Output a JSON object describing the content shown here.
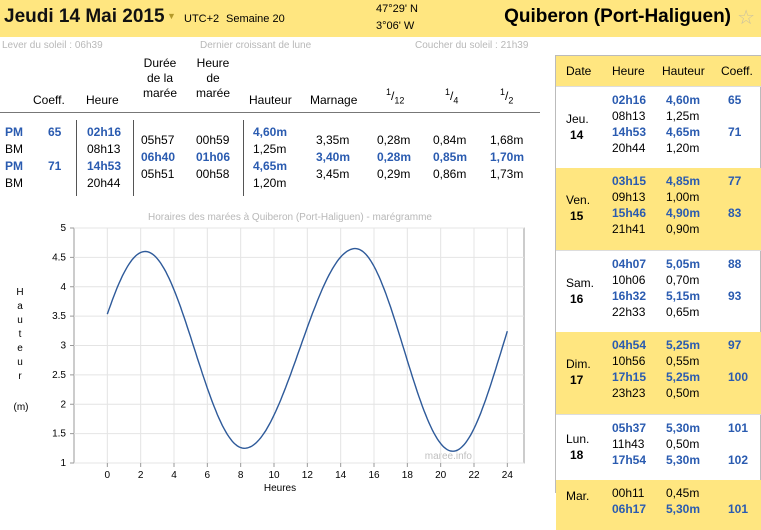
{
  "header": {
    "date": "Jeudi 14 Mai 2015",
    "timezone": "UTC+2",
    "week": "Semaine 20",
    "lat": "47°29' N",
    "lon": "3°06' W",
    "place": "Quiberon (Port-Haliguen)",
    "star_icon": "star-icon"
  },
  "subinfo": {
    "sunrise": "Lever du soleil : 06h39",
    "moon": "Dernier croissant de lune",
    "sunset": "Coucher du soleil : 21h39"
  },
  "table": {
    "headers": {
      "coeff": "Coeff.",
      "heure": "Heure",
      "duree": "Durée de la marée",
      "heure_maree": "Heure de marée",
      "hauteur": "Hauteur",
      "marnage": "Marnage",
      "f12_num": "1",
      "f12_den": "12",
      "f4_num": "1",
      "f4_den": "4",
      "f2_num": "1",
      "f2_den": "2"
    },
    "rows": [
      {
        "type": "PM",
        "coeff": "65",
        "heure": "02h16",
        "hauteur": "4,60m"
      },
      {
        "type": "BM",
        "coeff": "",
        "heure": "08h13",
        "hauteur": "1,25m"
      },
      {
        "type": "PM",
        "coeff": "71",
        "heure": "14h53",
        "hauteur": "4,65m"
      },
      {
        "type": "BM",
        "coeff": "",
        "heure": "20h44",
        "hauteur": "1,20m"
      }
    ],
    "intervals": [
      {
        "duree": "05h57",
        "heure_maree": "00h59",
        "marnage": "3,35m",
        "f12": "0,28m",
        "f4": "0,84m",
        "f2": "1,68m"
      },
      {
        "duree": "06h40",
        "heure_maree": "01h06",
        "marnage": "3,40m",
        "f12": "0,28m",
        "f4": "0,85m",
        "f2": "1,70m"
      },
      {
        "duree": "05h51",
        "heure_maree": "00h58",
        "marnage": "3,45m",
        "f12": "0,29m",
        "f4": "0,86m",
        "f2": "1,73m"
      }
    ]
  },
  "chart_data": {
    "type": "line",
    "title": "Horaires des marées à Quiberon (Port-Haliguen) - marégramme",
    "xlabel": "Heures",
    "ylabel": "Hauteur (m)",
    "ylabel_letters": [
      "H",
      "a",
      "u",
      "t",
      "e",
      "u",
      "r"
    ],
    "ylabel_unit": "(m)",
    "xlim": [
      -2,
      25
    ],
    "ylim": [
      1,
      5
    ],
    "xticks": [
      "0",
      "2",
      "4",
      "6",
      "8",
      "10",
      "12",
      "14",
      "16",
      "18",
      "20",
      "22",
      "24"
    ],
    "yticks": [
      "1",
      "1.5",
      "2",
      "2.5",
      "3",
      "3.5",
      "4",
      "4.5",
      "5"
    ],
    "watermark": "maree.info",
    "series": [
      {
        "x": [
          0,
          2.27,
          8.22,
          14.88,
          20.73,
          24
        ],
        "y": [
          3.9,
          4.6,
          1.25,
          4.65,
          1.2,
          3.25
        ]
      }
    ]
  },
  "side": {
    "headers": [
      "Date",
      "Heure",
      "Hauteur",
      "Coeff."
    ],
    "days": [
      {
        "day": "Jeu.",
        "num": "14",
        "highlight": false,
        "tides": [
          {
            "time": "02h16",
            "height": "4,60m",
            "coeff": "65",
            "pm": true
          },
          {
            "time": "08h13",
            "height": "1,25m",
            "coeff": "",
            "pm": false
          },
          {
            "time": "14h53",
            "height": "4,65m",
            "coeff": "71",
            "pm": true
          },
          {
            "time": "20h44",
            "height": "1,20m",
            "coeff": "",
            "pm": false
          }
        ]
      },
      {
        "day": "Ven.",
        "num": "15",
        "highlight": true,
        "tides": [
          {
            "time": "03h15",
            "height": "4,85m",
            "coeff": "77",
            "pm": true
          },
          {
            "time": "09h13",
            "height": "1,00m",
            "coeff": "",
            "pm": false
          },
          {
            "time": "15h46",
            "height": "4,90m",
            "coeff": "83",
            "pm": true
          },
          {
            "time": "21h41",
            "height": "0,90m",
            "coeff": "",
            "pm": false
          }
        ]
      },
      {
        "day": "Sam.",
        "num": "16",
        "highlight": false,
        "tides": [
          {
            "time": "04h07",
            "height": "5,05m",
            "coeff": "88",
            "pm": true
          },
          {
            "time": "10h06",
            "height": "0,70m",
            "coeff": "",
            "pm": false
          },
          {
            "time": "16h32",
            "height": "5,15m",
            "coeff": "93",
            "pm": true
          },
          {
            "time": "22h33",
            "height": "0,65m",
            "coeff": "",
            "pm": false
          }
        ]
      },
      {
        "day": "Dim.",
        "num": "17",
        "highlight": true,
        "tides": [
          {
            "time": "04h54",
            "height": "5,25m",
            "coeff": "97",
            "pm": true
          },
          {
            "time": "10h56",
            "height": "0,55m",
            "coeff": "",
            "pm": false
          },
          {
            "time": "17h15",
            "height": "5,25m",
            "coeff": "100",
            "pm": true
          },
          {
            "time": "23h23",
            "height": "0,50m",
            "coeff": "",
            "pm": false
          }
        ]
      },
      {
        "day": "Lun.",
        "num": "18",
        "highlight": false,
        "tides": [
          {
            "time": "05h37",
            "height": "5,30m",
            "coeff": "101",
            "pm": true
          },
          {
            "time": "11h43",
            "height": "0,50m",
            "coeff": "",
            "pm": false
          },
          {
            "time": "17h54",
            "height": "5,30m",
            "coeff": "102",
            "pm": true
          }
        ]
      },
      {
        "day": "Mar.",
        "num": "",
        "highlight": true,
        "tides": [
          {
            "time": "00h11",
            "height": "0,45m",
            "coeff": "",
            "pm": false
          },
          {
            "time": "06h17",
            "height": "5,30m",
            "coeff": "101",
            "pm": true
          }
        ]
      }
    ]
  },
  "colors": {
    "accent_yellow": "#ffe680",
    "blue": "#2a5bb0",
    "curve": "#2e5a9a"
  }
}
